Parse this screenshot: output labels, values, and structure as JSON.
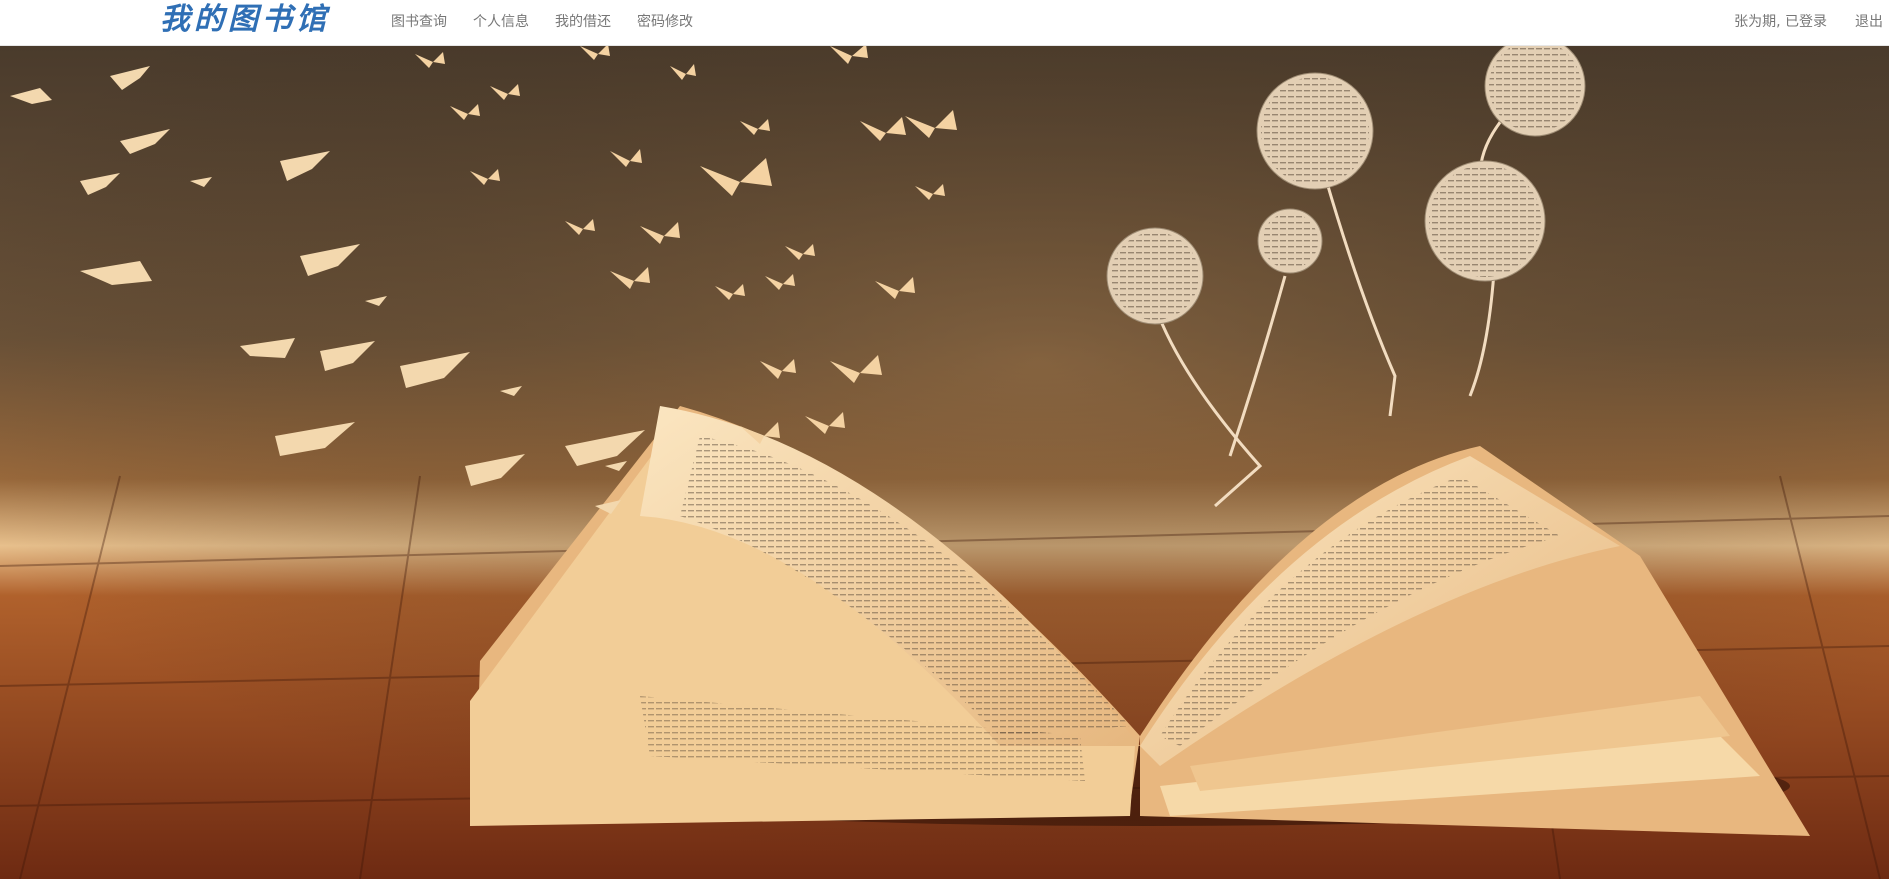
{
  "navbar": {
    "brand": "我的图书馆",
    "links": [
      {
        "label": "图书查询"
      },
      {
        "label": "个人信息"
      },
      {
        "label": "我的借还"
      },
      {
        "label": "密码修改"
      }
    ],
    "user_status": "张为期, 已登录",
    "logout": "退出"
  },
  "colors": {
    "brand": "#2f6fb5",
    "nav_text": "#777777",
    "navbar_bg": "#ffffff"
  },
  "hero": {
    "icon": "open-book-birds-butterflies-image"
  }
}
